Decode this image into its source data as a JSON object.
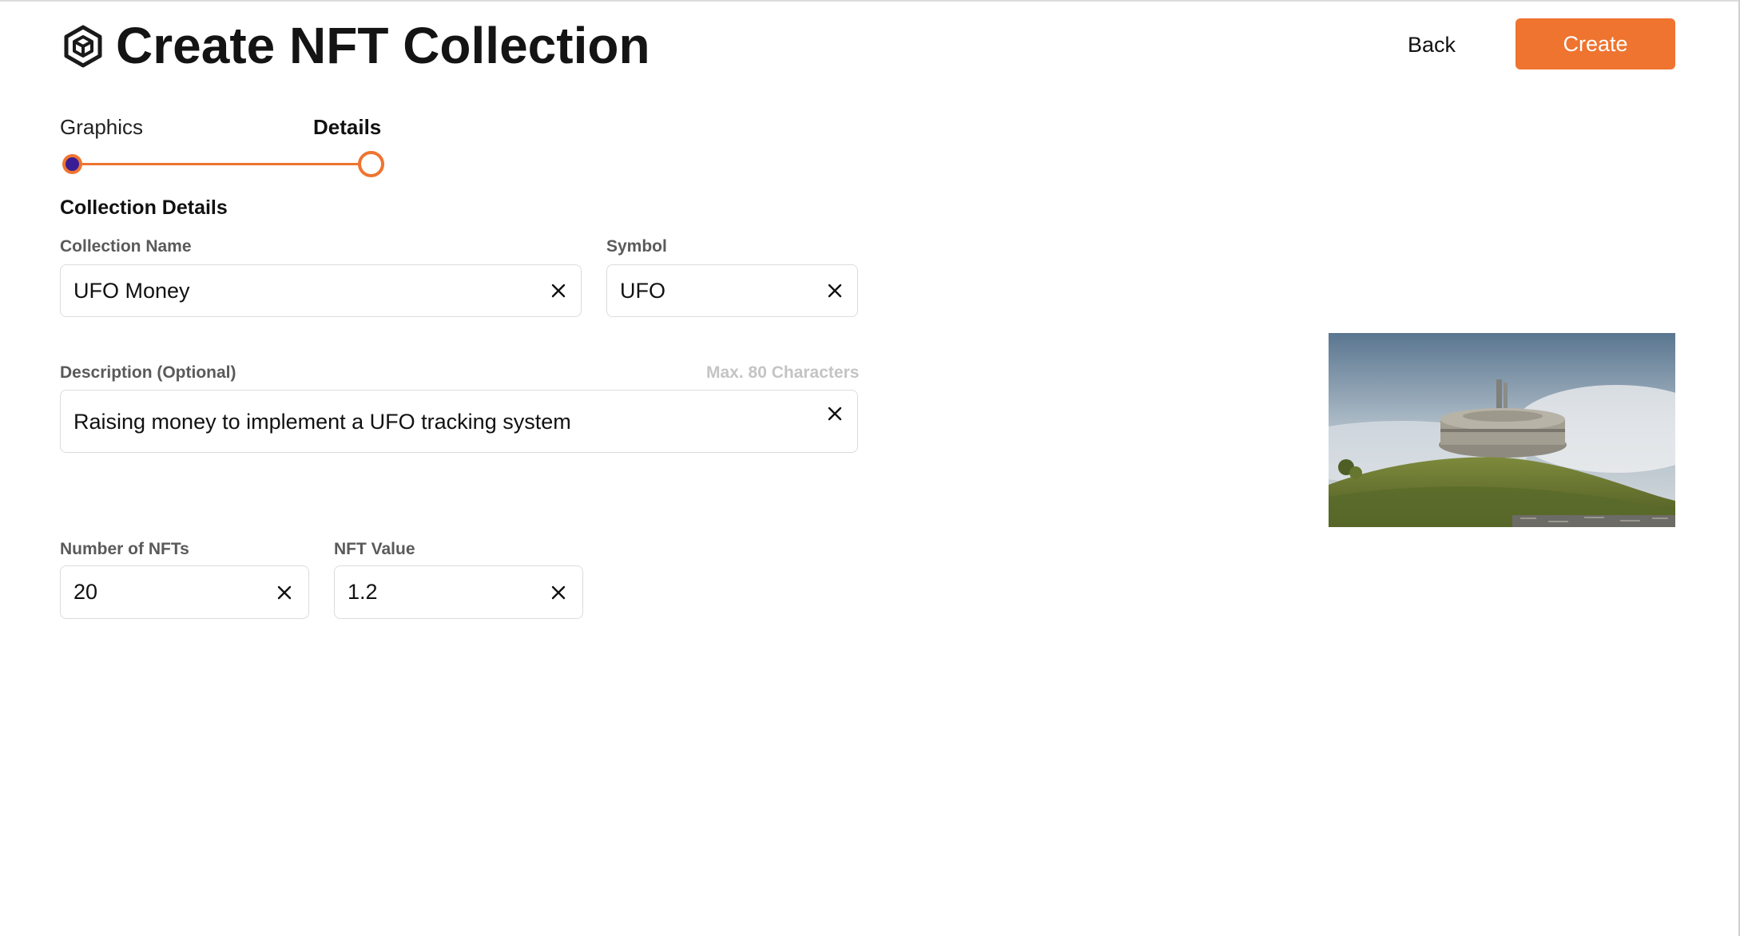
{
  "header": {
    "title": "Create NFT Collection",
    "back_label": "Back",
    "create_label": "Create"
  },
  "stepper": {
    "steps": [
      {
        "label": "Graphics",
        "state": "completed"
      },
      {
        "label": "Details",
        "state": "current"
      }
    ]
  },
  "form": {
    "section_title": "Collection Details",
    "collection_name": {
      "label": "Collection Name",
      "value": "UFO Money"
    },
    "symbol": {
      "label": "Symbol",
      "value": "UFO"
    },
    "description": {
      "label": "Description (Optional)",
      "hint": "Max. 80 Characters",
      "value": "Raising money to implement a UFO tracking system"
    },
    "number_of_nfts": {
      "label": "Number of NFTs",
      "value": "20"
    },
    "nft_value": {
      "label": "NFT Value",
      "value": "1.2"
    }
  },
  "icons": {
    "logo": "hexagon-cube-logo-icon",
    "clear": "close-icon"
  },
  "colors": {
    "accent": "#ee7430",
    "step_dot_fill": "#3a1d96",
    "label": "#5a5a5a",
    "hint": "#c4c4c4",
    "border": "#dcdcdc"
  }
}
